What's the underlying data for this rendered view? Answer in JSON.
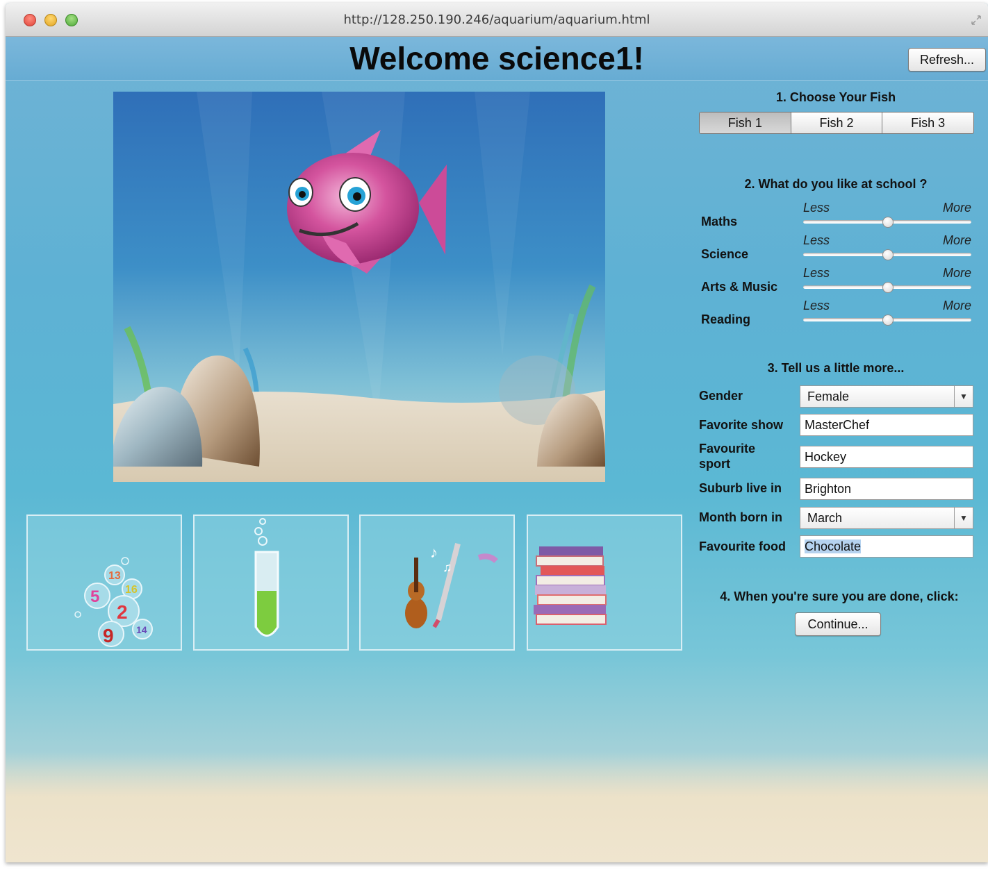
{
  "browser": {
    "url": "http://128.250.190.246/aquarium/aquarium.html"
  },
  "page": {
    "welcome": "Welcome science1!",
    "refresh_label": "Refresh..."
  },
  "section1": {
    "title": "1. Choose Your Fish",
    "fish_options": [
      "Fish 1",
      "Fish 2",
      "Fish 3"
    ],
    "selected": "Fish 1"
  },
  "section2": {
    "title": "2. What do you like at school ?",
    "less_label": "Less",
    "more_label": "More",
    "sliders": [
      {
        "label": "Maths",
        "value": 0.5
      },
      {
        "label": "Science",
        "value": 0.5
      },
      {
        "label": "Arts & Music",
        "value": 0.5
      },
      {
        "label": "Reading",
        "value": 0.5
      }
    ]
  },
  "section3": {
    "title": "3. Tell us a little more...",
    "gender_label": "Gender",
    "gender_value": "Female",
    "show_label": "Favorite show",
    "show_value": "MasterChef",
    "sport_label_line1": "Favourite",
    "sport_label_line2": "sport",
    "sport_value": "Hockey",
    "suburb_label": "Suburb live in",
    "suburb_value": "Brighton",
    "month_label": "Month born in",
    "month_value": "March",
    "food_label": "Favourite food",
    "food_value": "Chocolate"
  },
  "section4": {
    "title": "4. When you're sure you are done, click:",
    "continue_label": "Continue..."
  },
  "tiles": {
    "numbers": [
      "13",
      "5",
      "16",
      "2",
      "9",
      "14"
    ]
  },
  "colors": {
    "fish": "#c23f8f",
    "water": "#5eb1d4",
    "sand": "#e9dcc3"
  }
}
